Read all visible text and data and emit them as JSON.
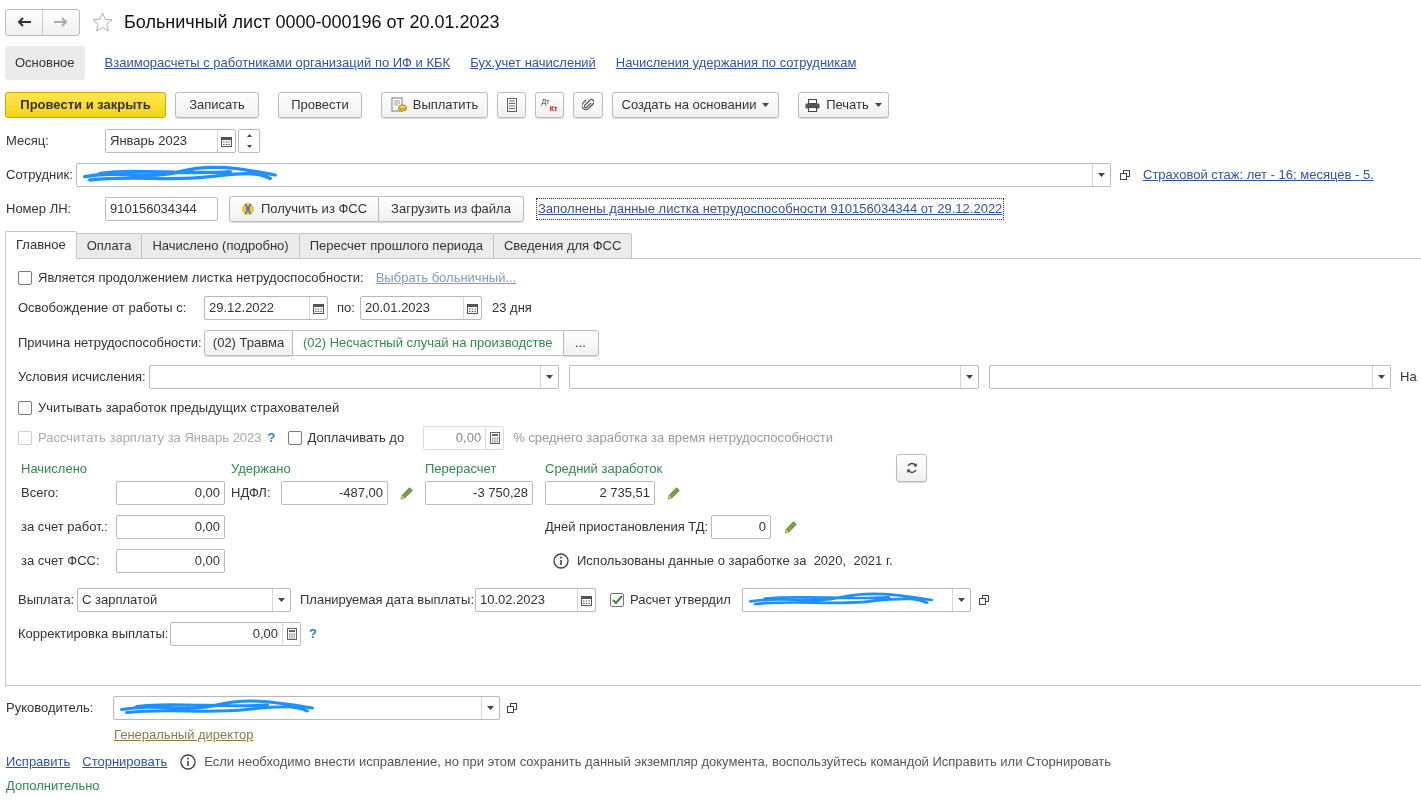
{
  "window": {
    "title": "Больничный лист 0000-000196 от 20.01.2023",
    "favorite": false
  },
  "sections": [
    {
      "label": "Основное",
      "selected": true
    },
    {
      "label": "Взаиморасчеты с работниками организаций по ИФ и КБК",
      "selected": false
    },
    {
      "label": "Бух.учет начислений",
      "selected": false
    },
    {
      "label": "Начисления удержания по сотрудникам",
      "selected": false
    }
  ],
  "toolbar": [
    {
      "kind": "primary",
      "label": "Провести и закрыть"
    },
    {
      "kind": "button",
      "label": "Записать"
    },
    {
      "kind": "button",
      "label": "Провести"
    },
    {
      "kind": "pay",
      "label": "Выплатить"
    },
    {
      "kind": "list"
    },
    {
      "kind": "dtkt",
      "labels": [
        "Дт",
        "Кт"
      ]
    },
    {
      "kind": "attach"
    },
    {
      "kind": "menu",
      "label": "Создать на основании"
    },
    {
      "kind": "print",
      "label": "Печать"
    }
  ],
  "header_fields": {
    "month": {
      "label": "Месяц:",
      "value": "Январь 2023"
    },
    "employee": {
      "label": "Сотрудник:",
      "redacted": true
    },
    "insurance_period_link": "Страховой стаж: лет - 16; месяцев - 5.",
    "sick_leave_number": {
      "label": "Номер ЛН:",
      "value": "910156034344"
    },
    "fss_buttons": [
      "Получить из ФСС",
      "Загрузить из файла"
    ],
    "filled_data_link": "Заполнены данные листка нетрудоспособности 910156034344 от 29.12.2022"
  },
  "tabs": [
    {
      "label": "Главное",
      "selected": true
    },
    {
      "label": "Оплата",
      "selected": false
    },
    {
      "label": "Начислено (подробно)",
      "selected": false
    },
    {
      "label": "Пересчет прошлого периода",
      "selected": false
    },
    {
      "label": "Сведения для ФСС",
      "selected": false
    }
  ],
  "main_tab": {
    "continuation": {
      "label": "Является продолжением листка нетрудоспособности:",
      "checked": false,
      "link": "Выбрать больничный..."
    },
    "release": {
      "label": "Освобождение от работы с:",
      "from": "29.12.2022",
      "to_label": "по:",
      "to": "20.01.2023",
      "days": "23 дня"
    },
    "reason": {
      "label": "Причина нетрудоспособности:",
      "code": "(02) Травма",
      "value": "(02) Несчастный случай на производстве",
      "button": "..."
    },
    "conditions": {
      "label": "Условия исчисления:",
      "trailing_label": "На"
    },
    "previous_insurers": {
      "label": "Учитывать заработок предыдущих страхователей",
      "checked": false
    },
    "calc_salary": {
      "label": "Рассчитать зарплату за Январь 2023",
      "checked": false,
      "disabled": true,
      "help": "?"
    },
    "top_up": {
      "label": "Доплачивать до",
      "checked": false,
      "value": "0,00",
      "suffix": "% среднего заработка за время нетрудоспособности",
      "disabled": true
    },
    "accrued": {
      "heading": "Начислено",
      "rows": [
        {
          "label": "Всего:",
          "value": "0,00"
        },
        {
          "label": "за счет работ.:",
          "value": "0,00"
        },
        {
          "label": "за счет ФСС:",
          "value": "0,00"
        }
      ]
    },
    "withheld": {
      "heading": "Удержано",
      "label": "НДФЛ:",
      "value": "-487,00"
    },
    "recalculation": {
      "heading": "Перерасчет",
      "value": "-3 750,28"
    },
    "average_earnings": {
      "heading": "Средний заработок",
      "value": "2 735,51"
    },
    "suspension_days": {
      "label": "Дней приостановления ТД:",
      "value": "0"
    },
    "earnings_info": "Использованы данные о заработке за  2020,  2021 г.",
    "payment": {
      "label": "Выплата:",
      "value": "С зарплатой"
    },
    "planned_date": {
      "label": "Планируемая дата выплаты:",
      "value": "10.02.2023"
    },
    "approved": {
      "label": "Расчет утвердил",
      "checked": true,
      "redacted": true
    },
    "payment_adjustment": {
      "label": "Корректировка выплаты:",
      "value": "0,00",
      "help": "?"
    }
  },
  "manager": {
    "label": "Руководитель:",
    "redacted": true,
    "position": "Генеральный директор"
  },
  "correction": {
    "links": [
      "Исправить",
      "Сторнировать"
    ],
    "info": "Если необходимо внести исправление, но при этом сохранить данный экземпляр документа, воспользуйтесь командой Исправить или Сторнировать"
  },
  "additional_heading": "Дополнительно"
}
